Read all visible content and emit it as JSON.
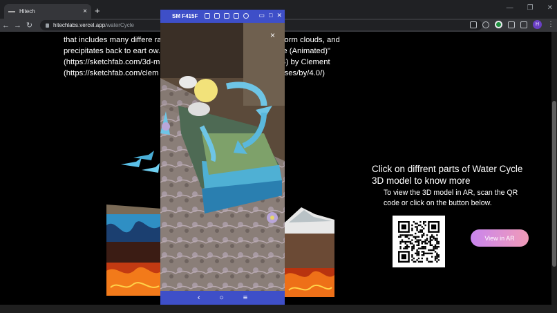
{
  "browser": {
    "tab_title": "Hitech",
    "tab_close": "×",
    "new_tab": "+",
    "url_host": "hitechlabs.vercel.app",
    "url_path": "/waterCycle",
    "profile_initial": "H",
    "window_controls": [
      "—",
      "❐",
      "✕"
    ]
  },
  "page": {
    "description_lines": [
      "that includes many differe                                    rates into water vapor, condenses to form clouds, and",
      "precipitates back to eart                                    ow.. This work is based on \"Water Cycle (Animated)\"",
      "(https://sketchfab.com/3d-m                                  e16058fa94e618829447db71ddba4)          by          Clement",
      "(https://sketchfab.com/clem                                  .0 (http://creativecommons.org/licenses/by/4.0/)"
    ],
    "info_title": "Click on diffrent parts of Water Cycle 3D model to know more",
    "info_subtitle": "To view the 3D model in AR, scan the QR code or click on the button below.",
    "ar_button_label": "View in AR"
  },
  "phone": {
    "device_name": "SM F415F",
    "close_glyph": "×",
    "nav": [
      "‹",
      "○",
      "≡"
    ]
  },
  "colors": {
    "phone_bar": "#3e4fc8",
    "ar_button_start": "#c985ee",
    "ar_button_end": "#f19bb8"
  }
}
